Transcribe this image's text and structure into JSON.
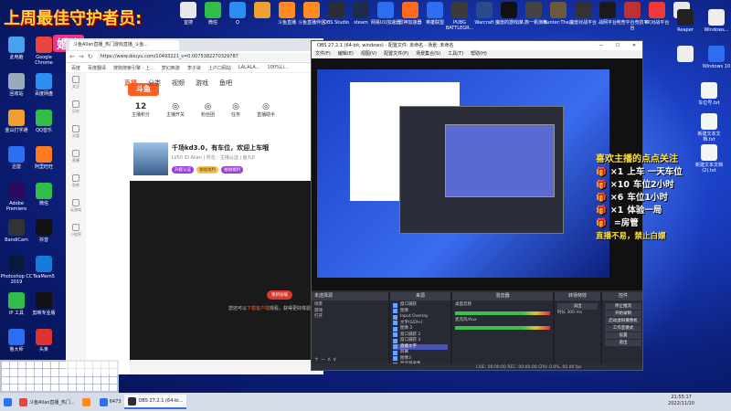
{
  "banner": "上周最佳守护者员:",
  "logo_badge": "婚冶",
  "desktop_top": [
    {
      "label": "宜搜",
      "color": "#e8e8ea"
    },
    {
      "label": "微信",
      "color": "#2fbf48"
    },
    {
      "label": "Q",
      "color": "#2b8ef0"
    },
    {
      "label": "",
      "color": "#f0a030"
    },
    {
      "label": "斗鱼直播",
      "color": "#ff8a1f"
    },
    {
      "label": "斗鱼直播伴侣",
      "color": "#ff8a1f"
    },
    {
      "label": "OBS Studio",
      "color": "#2b2e38"
    },
    {
      "label": "steam",
      "color": "#1c2c4a"
    },
    {
      "label": "网易UU加速器",
      "color": "#2b6ef0"
    },
    {
      "label": "雷神加速器",
      "color": "#ff6a1f"
    },
    {
      "label": "英雄联盟",
      "color": "#2b6ef0"
    },
    {
      "label": "PUBG BATTLEGR...",
      "color": "#3b3b3b"
    },
    {
      "label": "Warcraft",
      "color": "#2b4a8c"
    },
    {
      "label": "魔兽的游戏库",
      "color": "#111"
    },
    {
      "label": "人族一帆演练",
      "color": "#444"
    },
    {
      "label": "Hunter:The...",
      "color": "#6a5a3a"
    },
    {
      "label": "魔兽对战平台",
      "color": "#333"
    },
    {
      "label": "战网平台",
      "color": "#1a1a1a"
    },
    {
      "label": "电竞平台竞技平台",
      "color": "#c03030"
    },
    {
      "label": "KK对战平台",
      "color": "#ee3a3a"
    },
    {
      "label": "",
      "color": "#e8e8ea"
    }
  ],
  "desktop_left": [
    {
      "label": "此电脑",
      "color": "#4aa0f0"
    },
    {
      "label": "Google Chrome",
      "color": "#e8453c"
    },
    {
      "label": "回收站",
      "color": "#9ab"
    },
    {
      "label": "百度网盘",
      "color": "#2b8ef0"
    },
    {
      "label": "金山打字通",
      "color": "#f0a030"
    },
    {
      "label": "QQ音乐",
      "color": "#2fbf48"
    },
    {
      "label": "迅雷",
      "color": "#2b6ef0"
    },
    {
      "label": "阿里旺旺",
      "color": "#ff7a1f"
    },
    {
      "label": "Adobe Premiere",
      "color": "#2a0a5c"
    },
    {
      "label": "微信",
      "color": "#2fbf48"
    },
    {
      "label": "BandiCam",
      "color": "#333"
    },
    {
      "label": "抖音",
      "color": "#111"
    },
    {
      "label": "Photoshop CC 2019",
      "color": "#0a1a3c"
    },
    {
      "label": "TeaMem5",
      "color": "#1a7ad9"
    },
    {
      "label": "IP 工具",
      "color": "#2fbf48"
    },
    {
      "label": "剪映专业版",
      "color": "#111"
    },
    {
      "label": "鲁大师",
      "color": "#2b6ef0"
    },
    {
      "label": "头条",
      "color": "#d33"
    }
  ],
  "desktop_right": [
    {
      "label": "Reaper",
      "color": "#222"
    },
    {
      "label": "Windows...",
      "color": "#eee"
    },
    {
      "label": "",
      "color": "#eee"
    },
    {
      "label": "Windows 10",
      "color": "#2b6ef0"
    },
    {
      "label": "车位号.txt",
      "color": "#f4f4f4"
    },
    {
      "label": "新建文本文档.txt",
      "color": "#f4f4f4"
    },
    {
      "label": "新建文本文档(2).txt",
      "color": "#f4f4f4"
    }
  ],
  "browser": {
    "tab": "斗鱼Allan直播_热门游戏直播_斗鱼...",
    "url": "https://www.douyu.com/10493221_s=0.0075382270329787",
    "bookmarks": [
      "百度",
      "百度翻译",
      "搜狗搜索引擎 - 上...",
      "梦幻西游",
      "李子柒",
      "上户口网站",
      "LALALA...",
      "100%Li..."
    ],
    "rail": [
      "关注",
      "历史",
      "分类",
      "直播",
      "鱼吧",
      "云游戏",
      "小程序"
    ],
    "site_logo": "斗鱼",
    "nav": [
      "直播",
      "分类",
      "视频",
      "游戏",
      "鱼吧"
    ],
    "stats": [
      {
        "value": "12",
        "label": "主播积分"
      },
      {
        "value": "",
        "label": "主播开关"
      },
      {
        "value": "",
        "label": "粉丝团"
      },
      {
        "value": "",
        "label": "任务"
      },
      {
        "value": "",
        "label": "直播助手"
      }
    ],
    "room_title": "千场kd3.0，有车位，欢迎上车哦",
    "room_sub": "LV50  ID Allan  |  所在：主播认证  |  鱼丸0",
    "tags": [
      "升级认证",
      "福福福利",
      "福福福利"
    ],
    "load_btn": "重新加载",
    "player_msg_pre": "您还可以",
    "player_msg_link": "下载客户端",
    "player_msg_post": "观看，获得更好体验"
  },
  "obs": {
    "title": "OBS 27.2.1 (64-bit, windows) - 配置文件: 未命名 - 场景: 未命名",
    "menu": [
      "文件(F)",
      "编辑(E)",
      "视图(V)",
      "配置文件(P)",
      "场景集合(S)",
      "工具(T)",
      "帮助(H)"
    ],
    "no_source": "未选择源",
    "docks": {
      "scenes": {
        "title": "场景",
        "items": [
          "场景",
          "游戏",
          "打开"
        ]
      },
      "sources": {
        "title": "来源",
        "items": [
          "窗口捕获",
          "图像",
          "Input Overlay",
          "文字(GDI+)",
          "图像 2",
          "窗口捕获 2",
          "窗口捕获 3",
          "直播文字",
          "屏幕",
          "图像3",
          "显示器采集",
          "媒体源"
        ]
      },
      "mixer": {
        "title": "混音器",
        "items": [
          "桌面音频",
          "麦克风/Aux"
        ]
      },
      "transition": {
        "title": "转场特效",
        "fade": "淡出",
        "duration_label": "时长",
        "duration": "300 ms"
      },
      "controls": {
        "title": "控件",
        "buttons": [
          "停止推流",
          "开始录制",
          "启动虚拟摄像机",
          "工作室模式",
          "设置",
          "退出"
        ]
      }
    },
    "status": "LIVE: 00:00:00   REC: 00:00:00   CPU: 0.0%, 60.00 fps"
  },
  "promo": {
    "head": "喜欢主播的点点关注",
    "rows": [
      {
        "n": "×1",
        "t": "上车 一天车位"
      },
      {
        "n": "×10",
        "t": "车位2小时"
      },
      {
        "n": "×6",
        "t": "车位1小时"
      },
      {
        "n": "×1",
        "t": "体验一局"
      },
      {
        "n": "",
        "t": "=房管"
      }
    ],
    "warn": "直播不易，禁止白嫖"
  },
  "taskbar": {
    "items": [
      "斗鱼Allan直播_热门...",
      "",
      "6473",
      "OBS 27.2.1 (64-bi..."
    ],
    "time": "21:55:17",
    "date": "2022/11/10"
  }
}
